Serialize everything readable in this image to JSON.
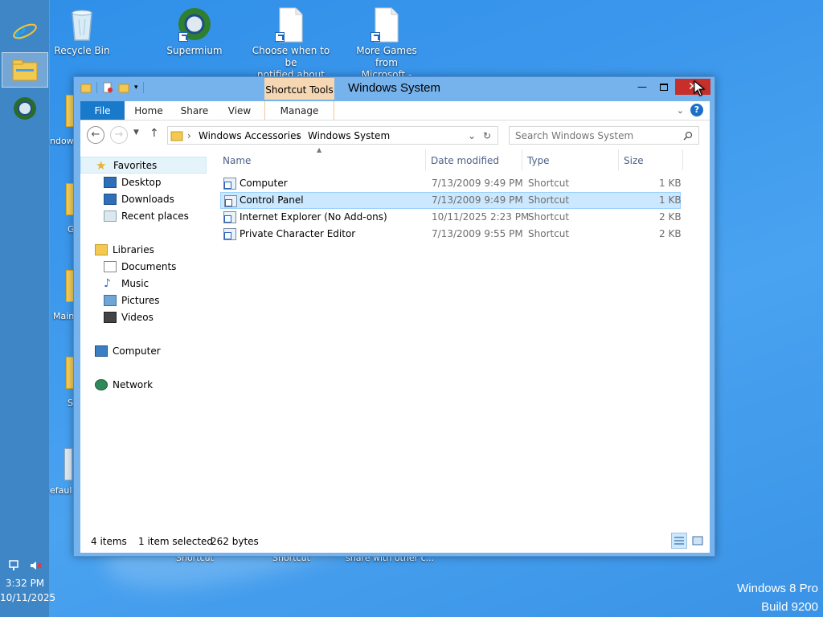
{
  "desktop": {
    "icons": [
      {
        "label_1": "Recycle Bin",
        "label_2": "",
        "icon": "recycle-bin-icon"
      },
      {
        "label_1": "Supermium",
        "label_2": "",
        "icon": "supermium-icon"
      },
      {
        "label_1": "Choose when to be",
        "label_2": "notified about cha...",
        "icon": "document-shortcut-icon"
      },
      {
        "label_1": "More Games from",
        "label_2": "Microsoft - Shortcut",
        "icon": "document-shortcut-icon"
      }
    ],
    "partial_labels": [
      "ndows",
      "G",
      "Main",
      "S",
      "efaul"
    ],
    "bottom_partial_labels": [
      "Shortcut",
      "Shortcut",
      "share with other c..."
    ],
    "watermark": {
      "line1": "Windows 8 Pro",
      "line2": "Build 9200"
    }
  },
  "taskbar": {
    "buttons": [
      {
        "name": "internet-explorer",
        "icon": "internet-explorer-icon",
        "active": false
      },
      {
        "name": "file-explorer",
        "icon": "file-explorer-icon",
        "active": true
      },
      {
        "name": "supermium",
        "icon": "supermium-icon",
        "active": false
      }
    ],
    "tray": {
      "network_icon": "network-icon",
      "volume_icon": "volume-muted-icon"
    },
    "clock": {
      "time": "3:32 PM",
      "date": "10/11/2025"
    }
  },
  "window": {
    "title": "Windows System",
    "contextual_tab_group": "Shortcut Tools",
    "ribbon_tabs": [
      "File",
      "Home",
      "Share",
      "View",
      "Manage"
    ],
    "address": {
      "crumb1": "Windows Accessories",
      "crumb2": "Windows System"
    },
    "search": {
      "placeholder": "Search Windows System"
    },
    "nav": {
      "favorites": {
        "header": "Favorites",
        "items": [
          "Desktop",
          "Downloads",
          "Recent places"
        ]
      },
      "libraries": {
        "header": "Libraries",
        "items": [
          "Documents",
          "Music",
          "Pictures",
          "Videos"
        ]
      },
      "computer": "Computer",
      "network": "Network"
    },
    "columns": {
      "name": "Name",
      "date": "Date modified",
      "type": "Type",
      "size": "Size"
    },
    "files": [
      {
        "name": "Computer",
        "date": "7/13/2009 9:49 PM",
        "type": "Shortcut",
        "size": "1 KB",
        "selected": false
      },
      {
        "name": "Control Panel",
        "date": "7/13/2009 9:49 PM",
        "type": "Shortcut",
        "size": "1 KB",
        "selected": true
      },
      {
        "name": "Internet Explorer (No Add-ons)",
        "date": "10/11/2025 2:23 PM",
        "type": "Shortcut",
        "size": "2 KB",
        "selected": false
      },
      {
        "name": "Private Character Editor",
        "date": "7/13/2009 9:55 PM",
        "type": "Shortcut",
        "size": "2 KB",
        "selected": false
      }
    ],
    "status": {
      "items": "4 items",
      "selected": "1 item selected",
      "bytes": "262 bytes"
    }
  },
  "colors": {
    "desktop": "#3b97ec",
    "taskbar": "#3f86c6",
    "accent": "#1979ca",
    "close": "#c7302a",
    "contextual": "#f6d7b4"
  }
}
